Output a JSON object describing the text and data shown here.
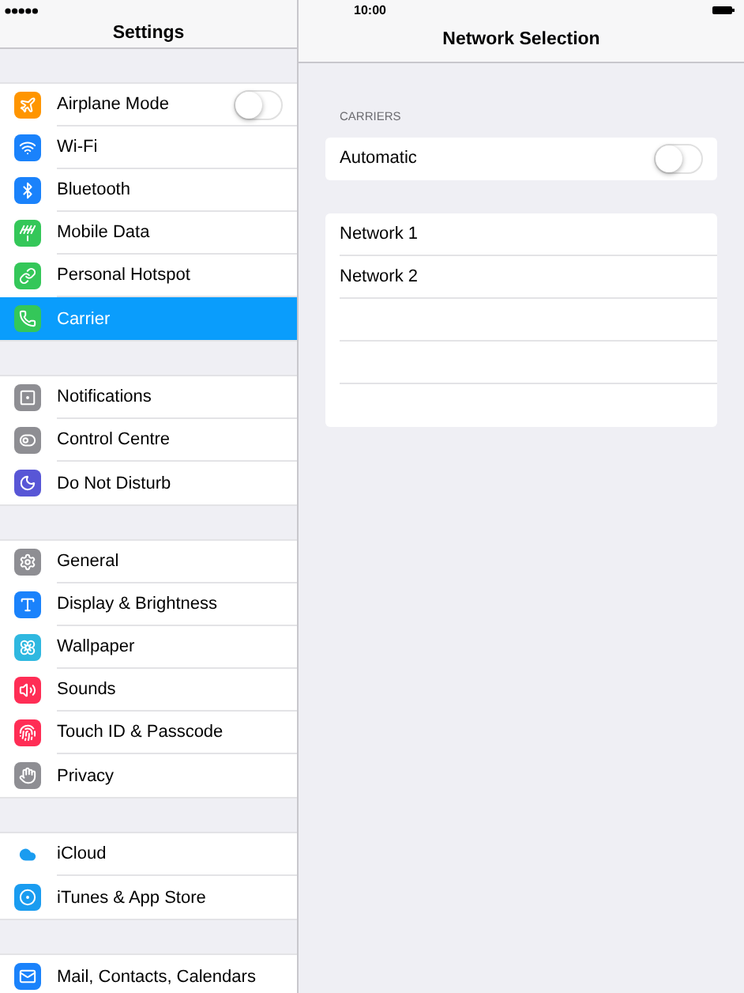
{
  "status_bar": {
    "time": "10:00"
  },
  "sidebar": {
    "title": "Settings",
    "sections": [
      {
        "items": [
          {
            "label": "Airplane Mode",
            "kind": "toggle",
            "on": false,
            "selected": false,
            "color": "#ff9500"
          },
          {
            "label": "Wi-Fi",
            "kind": "plain",
            "selected": false,
            "color": "#1a82fb"
          },
          {
            "label": "Bluetooth",
            "kind": "plain",
            "selected": false,
            "color": "#1a82fb"
          },
          {
            "label": "Mobile Data",
            "kind": "plain",
            "selected": false,
            "color": "#34c759"
          },
          {
            "label": "Personal Hotspot",
            "kind": "plain",
            "selected": false,
            "color": "#34c759"
          },
          {
            "label": "Carrier",
            "kind": "plain",
            "selected": true,
            "color": "#34c759"
          }
        ]
      },
      {
        "items": [
          {
            "label": "Notifications",
            "kind": "plain",
            "selected": false,
            "color": "#8e8e93"
          },
          {
            "label": "Control Centre",
            "kind": "plain",
            "selected": false,
            "color": "#8e8e93"
          },
          {
            "label": "Do Not Disturb",
            "kind": "plain",
            "selected": false,
            "color": "#5856d6"
          }
        ]
      },
      {
        "items": [
          {
            "label": "General",
            "kind": "plain",
            "selected": false,
            "color": "#8e8e93"
          },
          {
            "label": "Display & Brightness",
            "kind": "plain",
            "selected": false,
            "color": "#1a82fb"
          },
          {
            "label": "Wallpaper",
            "kind": "plain",
            "selected": false,
            "color": "#2fb8e0"
          },
          {
            "label": "Sounds",
            "kind": "plain",
            "selected": false,
            "color": "#ff2d55"
          },
          {
            "label": "Touch ID & Passcode",
            "kind": "plain",
            "selected": false,
            "color": "#ff2d55"
          },
          {
            "label": "Privacy",
            "kind": "plain",
            "selected": false,
            "color": "#8e8e93"
          }
        ]
      },
      {
        "items": [
          {
            "label": "iCloud",
            "kind": "plain",
            "selected": false,
            "color": "#ffffff"
          },
          {
            "label": "iTunes & App Store",
            "kind": "plain",
            "selected": false,
            "color": "#1a9cf0"
          }
        ]
      },
      {
        "items": [
          {
            "label": "Mail, Contacts, Calendars",
            "kind": "plain",
            "selected": false,
            "color": "#1a82fb"
          }
        ]
      }
    ]
  },
  "detail": {
    "title": "Network Selection",
    "section_header": "CARRIERS",
    "automatic": {
      "label": "Automatic",
      "on": false
    },
    "networks": [
      {
        "label": "Network 1"
      },
      {
        "label": "Network 2"
      }
    ]
  }
}
